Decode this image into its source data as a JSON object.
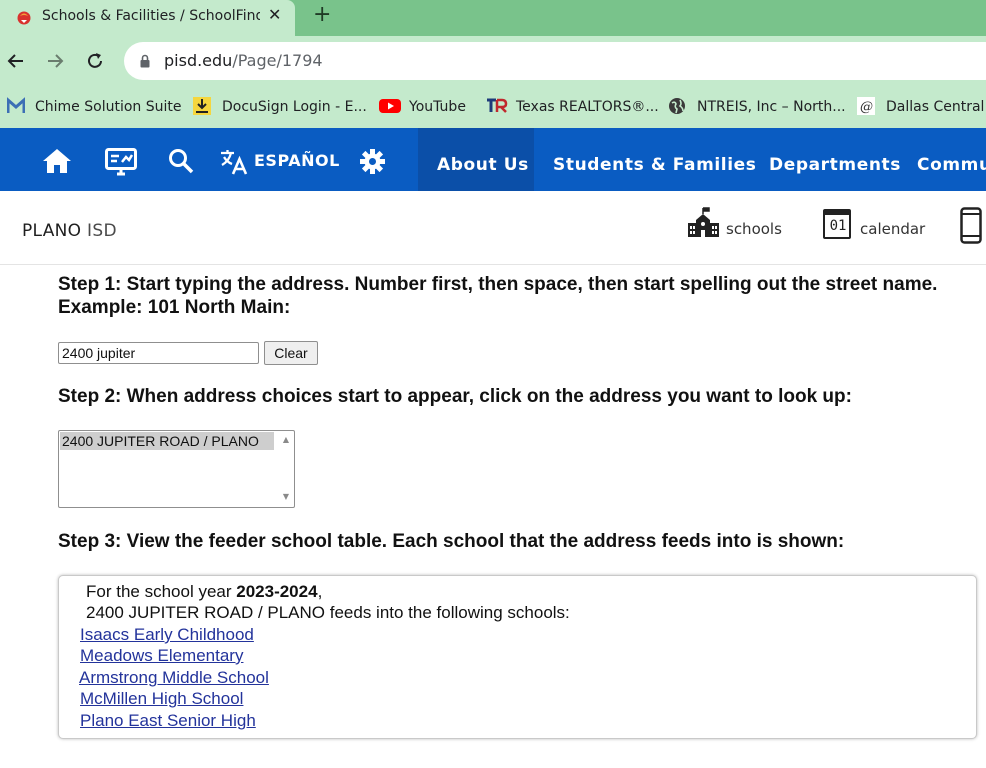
{
  "browser": {
    "tab_title": "Schools & Facilities / SchoolFinder",
    "tab_close": "✕",
    "new_tab": "+",
    "url_host": "pisd.edu",
    "url_path": "/Page/1794",
    "bookmarks": [
      {
        "label": "Chime Solution Suite",
        "icon": "chime-m-icon"
      },
      {
        "label": "DocuSign Login - E...",
        "icon": "docusign-download-icon"
      },
      {
        "label": "YouTube",
        "icon": "youtube-icon"
      },
      {
        "label": "Texas REALTORS®...",
        "icon": "texas-realtors-icon"
      },
      {
        "label": "NTREIS, Inc – North...",
        "icon": "globe-icon"
      },
      {
        "label": "Dallas Central A",
        "icon": "dallas-central-icon"
      }
    ]
  },
  "site_nav": {
    "espanol": "ESPAÑOL",
    "links": [
      "About Us",
      "Students & Families",
      "Departments",
      "Commu"
    ],
    "active": "About Us",
    "color": "#0a5cc2"
  },
  "header": {
    "brand_bold": "PLANO",
    "brand_rest": " ISD",
    "quick_links": [
      {
        "label": "schools",
        "icon": "school-building-icon"
      },
      {
        "label": "calendar",
        "icon": "calendar-icon",
        "icon_text": "01"
      },
      {
        "label": "",
        "icon": "mobile-phone-icon"
      }
    ]
  },
  "content": {
    "step1": "Step 1: Start typing the address. Number first, then space, then start spelling out the street name. Example: 101 North Main:",
    "address_value": "2400 jupiter",
    "clear_label": "Clear",
    "step2": "Step 2: When address choices start to appear, click on the address you want to look up:",
    "address_option": "2400 JUPITER ROAD / PLANO",
    "step3": "Step 3: View the feeder school table. Each school that the address feeds into is shown:",
    "year_prefix": "For the school year ",
    "year": "2023-2024",
    "year_suffix": ",",
    "feeds_line": "2400 JUPITER ROAD / PLANO feeds into the following schools:",
    "schools": [
      "Isaacs Early Childhood",
      "Meadows Elementary",
      "Armstrong Middle School",
      "McMillen High School",
      "Plano East Senior High"
    ],
    "link_color": "#23339b"
  }
}
